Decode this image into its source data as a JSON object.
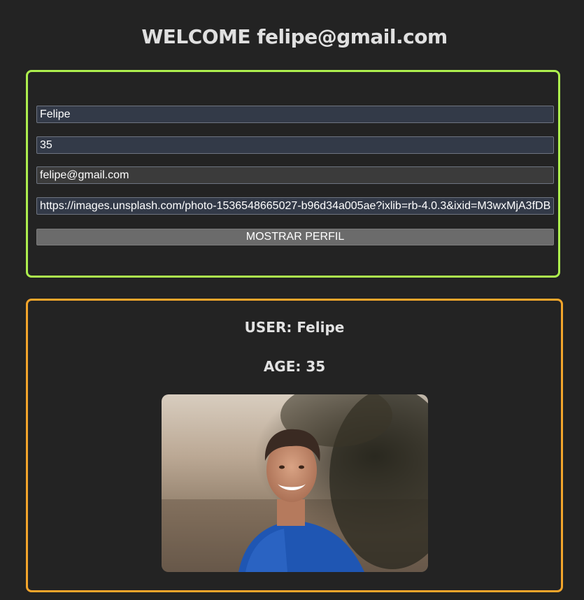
{
  "header": {
    "title": "WELCOME felipe@gmail.com"
  },
  "form": {
    "name_value": "Felipe",
    "age_value": "35",
    "email_value": "felipe@gmail.com",
    "image_url_value": "https://images.unsplash.com/photo-1536548665027-b96d34a005ae?ixlib=rb-4.0.3&ixid=M3wxMjA3fDB8MHxwaG90by1wYWdlfHx8fGVufDB8fHx8fA%3D%3D",
    "submit_label": "MOSTRAR PERFIL"
  },
  "profile": {
    "user_line": "USER: Felipe",
    "age_line": "AGE: 35",
    "photo": "smiling young man in a blue BRASIL t-shirt outdoors"
  },
  "colors": {
    "background": "#232323",
    "form_border": "#adef4e",
    "profile_border": "#f3a52b",
    "button": "#6b6b6b"
  }
}
